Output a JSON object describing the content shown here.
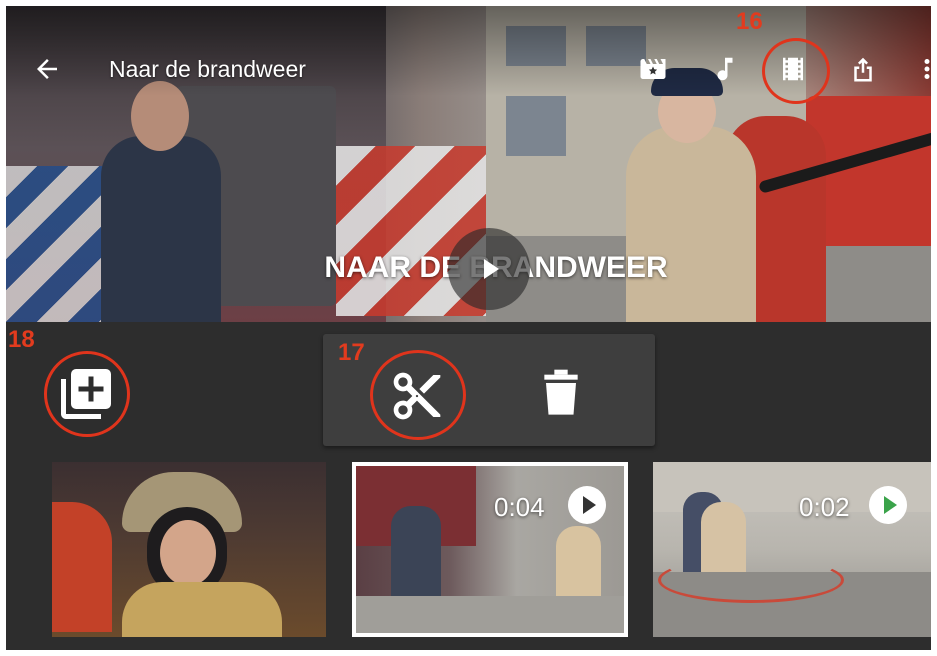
{
  "toolbar": {
    "title": "Naar de brandweer",
    "icons": [
      "back-arrow-icon",
      "theme-icon",
      "music-icon",
      "film-strip-icon",
      "share-icon",
      "more-vertical-icon"
    ]
  },
  "preview": {
    "overlay_title": "NAAR DE BRANDWEER",
    "accent": "#e0341c"
  },
  "annotations": {
    "marker_16": "16",
    "marker_17": "17",
    "marker_18": "18"
  },
  "clips": [
    {
      "duration": ""
    },
    {
      "duration": "0:04",
      "selected": true
    },
    {
      "duration": "0:02"
    }
  ]
}
